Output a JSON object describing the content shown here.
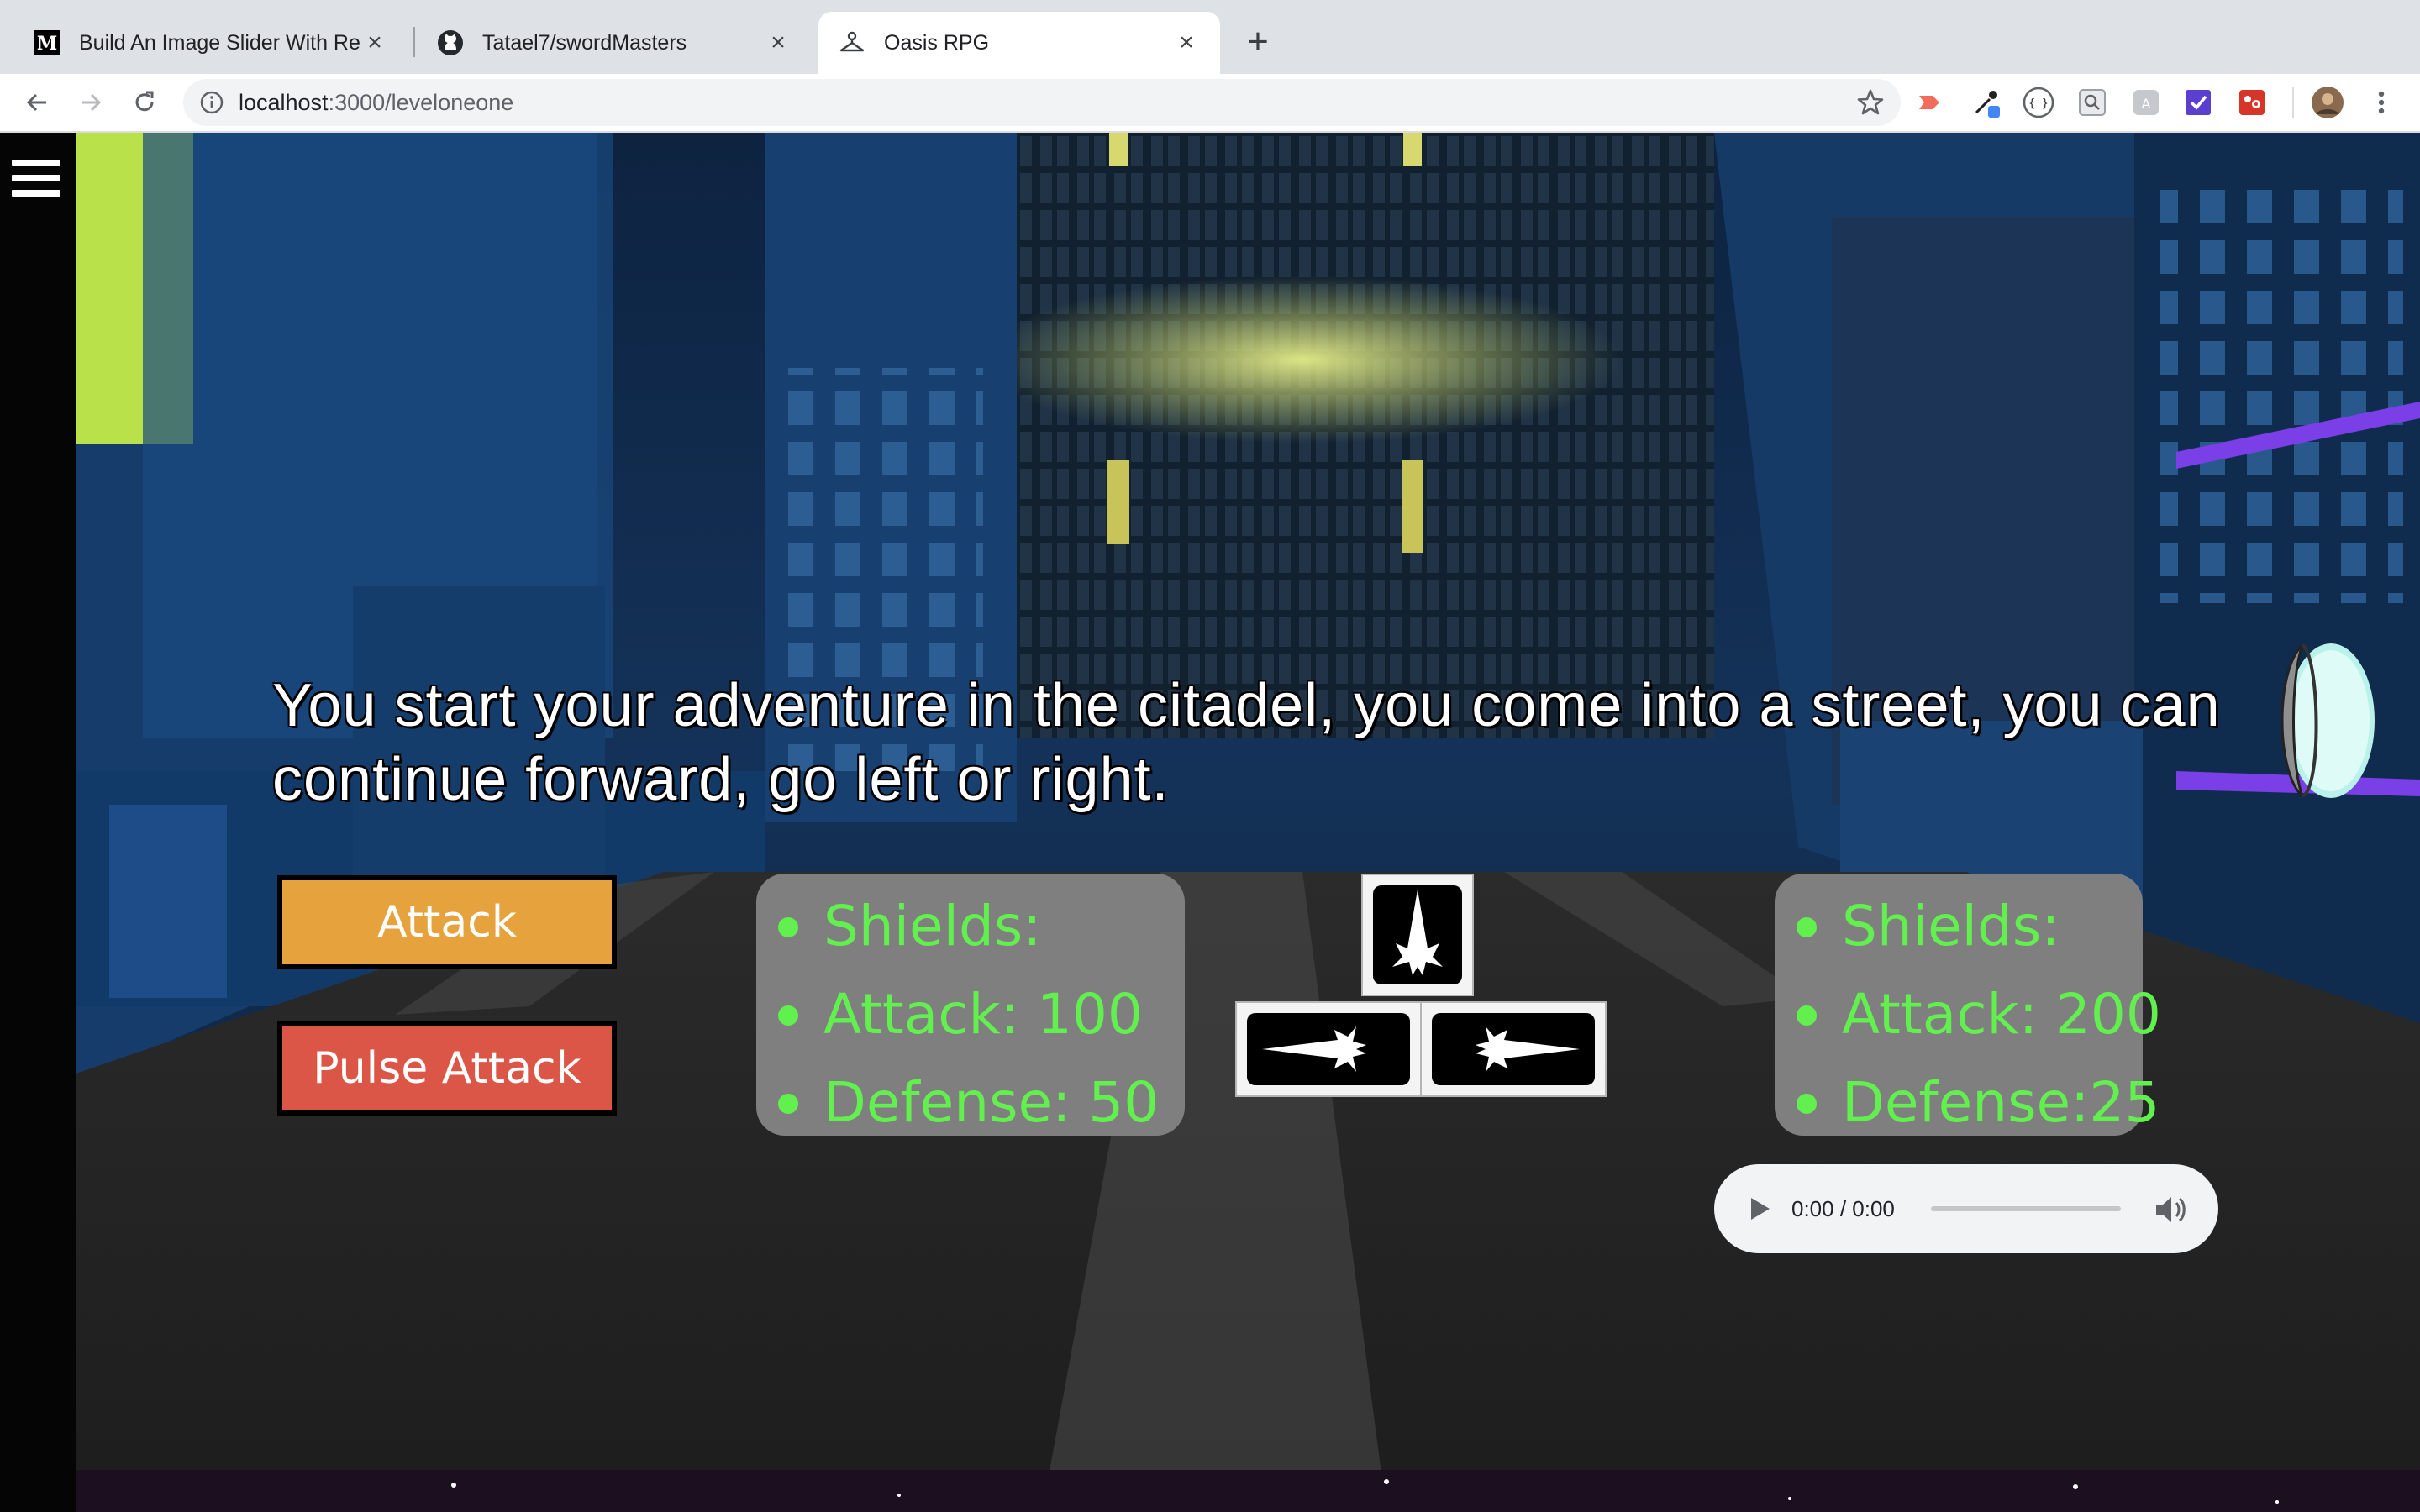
{
  "browser": {
    "tabs": [
      {
        "title": "Build An Image Slider With Rea",
        "favicon": "medium-icon",
        "active": false
      },
      {
        "title": "Tatael7/swordMasters",
        "favicon": "github-icon",
        "active": false
      },
      {
        "title": "Oasis RPG",
        "favicon": "hanger-icon",
        "active": true
      }
    ],
    "close_glyph": "×",
    "new_tab_glyph": "+",
    "url_host": "localhost",
    "url_path": ":3000/leveloneone"
  },
  "page": {
    "story_text": "You start your adventure in the citadel, you come into a street, you can continue forward, go left or right.",
    "buttons": {
      "attack": "Attack",
      "pulse_attack": "Pulse Attack"
    },
    "player_stats": [
      "Shields:",
      "Attack: 100",
      "Defense: 50"
    ],
    "enemy_stats": [
      "Shields:",
      "Attack: 200",
      "Defense:25"
    ],
    "audio": {
      "time": "0:00 / 0:00",
      "progress": 0
    }
  },
  "colors": {
    "attack_button": "#e6a23c",
    "pulse_button": "#dc5648",
    "stat_text": "#62f04e",
    "stat_panel": "#7f7f7f"
  }
}
